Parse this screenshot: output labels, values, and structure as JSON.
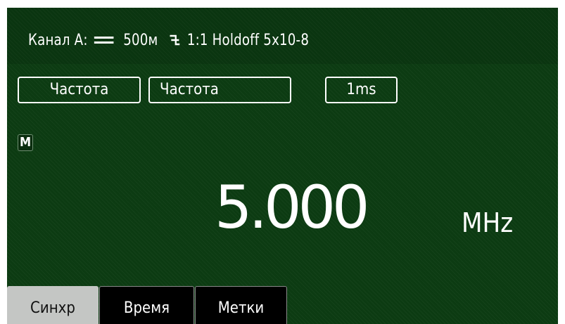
{
  "channel": {
    "label": "Канал А:",
    "coupling_icon": "dc-coupling-icon",
    "level": "500м",
    "slope_icon": "falling-edge-icon",
    "attenuation": "1:1",
    "holdoff_label": "Holdoff",
    "holdoff_value": "5x10-8"
  },
  "controls": {
    "function_primary": "Частота",
    "function_secondary": "Частота",
    "gate_time": "1ms"
  },
  "mode_badge": "M",
  "reading": {
    "value": "5.000",
    "unit": "MHz"
  },
  "tabs": [
    {
      "label": "Синхр",
      "active": true
    },
    {
      "label": "Время",
      "active": false
    },
    {
      "label": "Метки",
      "active": false
    }
  ],
  "colors": {
    "background": "#0c3b12",
    "text": "#ffffff",
    "active_tab": "#c4c6c4",
    "inactive_tab": "#000000"
  }
}
